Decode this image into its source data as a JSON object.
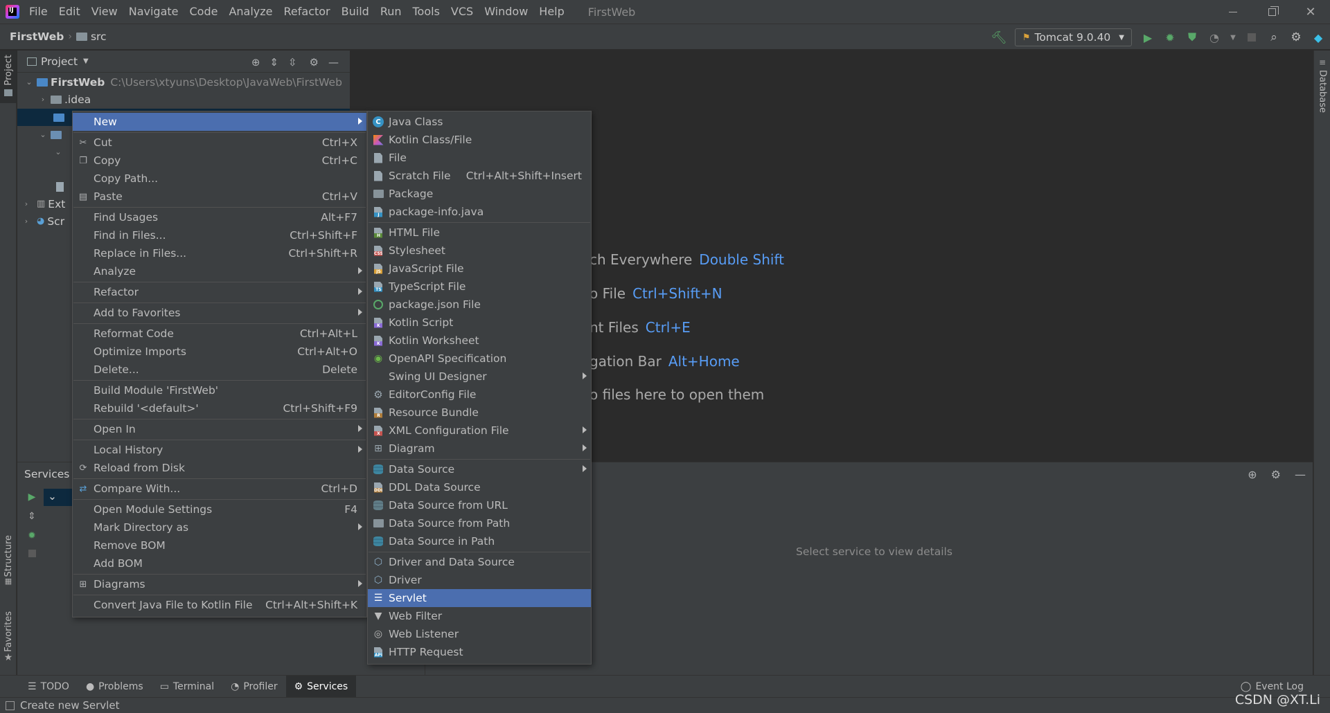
{
  "menubar": {
    "items": [
      "File",
      "Edit",
      "View",
      "Navigate",
      "Code",
      "Analyze",
      "Refactor",
      "Build",
      "Run",
      "Tools",
      "VCS",
      "Window",
      "Help"
    ],
    "window_title": "FirstWeb"
  },
  "navbar": {
    "breadcrumb_project": "FirstWeb",
    "breadcrumb_folder": "src",
    "run_config": "Tomcat 9.0.40"
  },
  "side_tabs": {
    "project": "Project",
    "structure": "Structure",
    "favorites": "Favorites",
    "database": "Database"
  },
  "project_panel": {
    "title": "Project",
    "root_name": "FirstWeb",
    "root_path": "C:\\Users\\xtyuns\\Desktop\\JavaWeb\\FirstWeb",
    "idea_folder": ".idea",
    "ext_label": "Ext",
    "scr_label": "Scr"
  },
  "editor_hints": [
    {
      "text": "ch Everywhere",
      "key": "Double Shift"
    },
    {
      "text": "o File",
      "key": "Ctrl+Shift+N"
    },
    {
      "text": "nt Files",
      "key": "Ctrl+E"
    },
    {
      "text": "gation Bar",
      "key": "Alt+Home"
    },
    {
      "text": "o files here to open them",
      "key": ""
    }
  ],
  "services": {
    "title": "Services",
    "empty_text": "Select service to view details"
  },
  "context_menu": [
    {
      "label": "New",
      "shortcut": "",
      "submenu": true,
      "selected": true,
      "icon": ""
    },
    {
      "sep": true
    },
    {
      "label": "Cut",
      "shortcut": "Ctrl+X",
      "icon": "scissors-icon"
    },
    {
      "label": "Copy",
      "shortcut": "Ctrl+C",
      "icon": "copy-icon"
    },
    {
      "label": "Copy Path...",
      "shortcut": ""
    },
    {
      "label": "Paste",
      "shortcut": "Ctrl+V",
      "icon": "paste-icon"
    },
    {
      "sep": true
    },
    {
      "label": "Find Usages",
      "shortcut": "Alt+F7"
    },
    {
      "label": "Find in Files...",
      "shortcut": "Ctrl+Shift+F"
    },
    {
      "label": "Replace in Files...",
      "shortcut": "Ctrl+Shift+R"
    },
    {
      "label": "Analyze",
      "shortcut": "",
      "submenu": true
    },
    {
      "sep": true
    },
    {
      "label": "Refactor",
      "shortcut": "",
      "submenu": true
    },
    {
      "sep": true
    },
    {
      "label": "Add to Favorites",
      "shortcut": "",
      "submenu": true
    },
    {
      "sep": true
    },
    {
      "label": "Reformat Code",
      "shortcut": "Ctrl+Alt+L"
    },
    {
      "label": "Optimize Imports",
      "shortcut": "Ctrl+Alt+O"
    },
    {
      "label": "Delete...",
      "shortcut": "Delete"
    },
    {
      "sep": true
    },
    {
      "label": "Build Module 'FirstWeb'",
      "shortcut": ""
    },
    {
      "label": "Rebuild '<default>'",
      "shortcut": "Ctrl+Shift+F9"
    },
    {
      "sep": true
    },
    {
      "label": "Open In",
      "shortcut": "",
      "submenu": true
    },
    {
      "sep": true
    },
    {
      "label": "Local History",
      "shortcut": "",
      "submenu": true
    },
    {
      "label": "Reload from Disk",
      "shortcut": "",
      "icon": "reload-icon"
    },
    {
      "sep": true
    },
    {
      "label": "Compare With...",
      "shortcut": "Ctrl+D",
      "icon": "compare-icon"
    },
    {
      "sep": true
    },
    {
      "label": "Open Module Settings",
      "shortcut": "F4"
    },
    {
      "label": "Mark Directory as",
      "shortcut": "",
      "submenu": true
    },
    {
      "label": "Remove BOM",
      "shortcut": ""
    },
    {
      "label": "Add BOM",
      "shortcut": ""
    },
    {
      "sep": true
    },
    {
      "label": "Diagrams",
      "shortcut": "",
      "submenu": true,
      "icon": "diagram-icon"
    },
    {
      "sep": true
    },
    {
      "label": "Convert Java File to Kotlin File",
      "shortcut": "Ctrl+Alt+Shift+K"
    }
  ],
  "sub_menu": [
    {
      "label": "Java Class",
      "icon": "java-class-icon"
    },
    {
      "label": "Kotlin Class/File",
      "icon": "kotlin-icon"
    },
    {
      "label": "File",
      "icon": "file-icon"
    },
    {
      "label": "Scratch File",
      "shortcut": "Ctrl+Alt+Shift+Insert",
      "icon": "scratch-file-icon"
    },
    {
      "label": "Package",
      "icon": "package-icon"
    },
    {
      "label": "package-info.java",
      "icon": "java-file-icon"
    },
    {
      "sep": true
    },
    {
      "label": "HTML File",
      "icon": "html-file-icon"
    },
    {
      "label": "Stylesheet",
      "icon": "css-file-icon"
    },
    {
      "label": "JavaScript File",
      "icon": "js-file-icon"
    },
    {
      "label": "TypeScript File",
      "icon": "ts-file-icon"
    },
    {
      "label": "package.json File",
      "icon": "npm-icon"
    },
    {
      "label": "Kotlin Script",
      "icon": "kotlin-script-icon"
    },
    {
      "label": "Kotlin Worksheet",
      "icon": "kotlin-worksheet-icon"
    },
    {
      "label": "OpenAPI Specification",
      "icon": "openapi-icon"
    },
    {
      "label": "Swing UI Designer",
      "submenu": true,
      "icon": ""
    },
    {
      "label": "EditorConfig File",
      "icon": "gear-icon"
    },
    {
      "label": "Resource Bundle",
      "icon": "resource-bundle-icon"
    },
    {
      "label": "XML Configuration File",
      "submenu": true,
      "icon": "xml-file-icon"
    },
    {
      "label": "Diagram",
      "submenu": true,
      "icon": "diagram-icon"
    },
    {
      "sep": true
    },
    {
      "label": "Data Source",
      "submenu": true,
      "icon": "database-icon"
    },
    {
      "label": "DDL Data Source",
      "icon": "ddl-icon"
    },
    {
      "label": "Data Source from URL",
      "icon": "url-icon"
    },
    {
      "label": "Data Source from Path",
      "icon": "folder-icon"
    },
    {
      "label": "Data Source in Path",
      "icon": "database-icon"
    },
    {
      "sep": true
    },
    {
      "label": "Driver and Data Source",
      "icon": "driver-icon"
    },
    {
      "label": "Driver",
      "icon": "driver-icon"
    },
    {
      "label": "Servlet",
      "selected": true,
      "icon": "servlet-icon"
    },
    {
      "label": "Web Filter",
      "icon": "filter-icon"
    },
    {
      "label": "Web Listener",
      "icon": "listener-icon"
    },
    {
      "label": "HTTP Request",
      "icon": "api-file-icon"
    }
  ],
  "bottom_tabs": [
    {
      "label": "TODO",
      "icon": "list-icon"
    },
    {
      "label": "Problems",
      "icon": "info-icon"
    },
    {
      "label": "Terminal",
      "icon": "terminal-icon"
    },
    {
      "label": "Profiler",
      "icon": "profiler-icon"
    },
    {
      "label": "Services",
      "icon": "services-icon",
      "active": true
    }
  ],
  "event_log": "Event Log",
  "status_text": "Create new Servlet",
  "watermark": "CSDN @XT.Li",
  "colors": {
    "selection": "#4b6eaf",
    "hint_key": "#589df6",
    "run_green": "#59a869"
  }
}
